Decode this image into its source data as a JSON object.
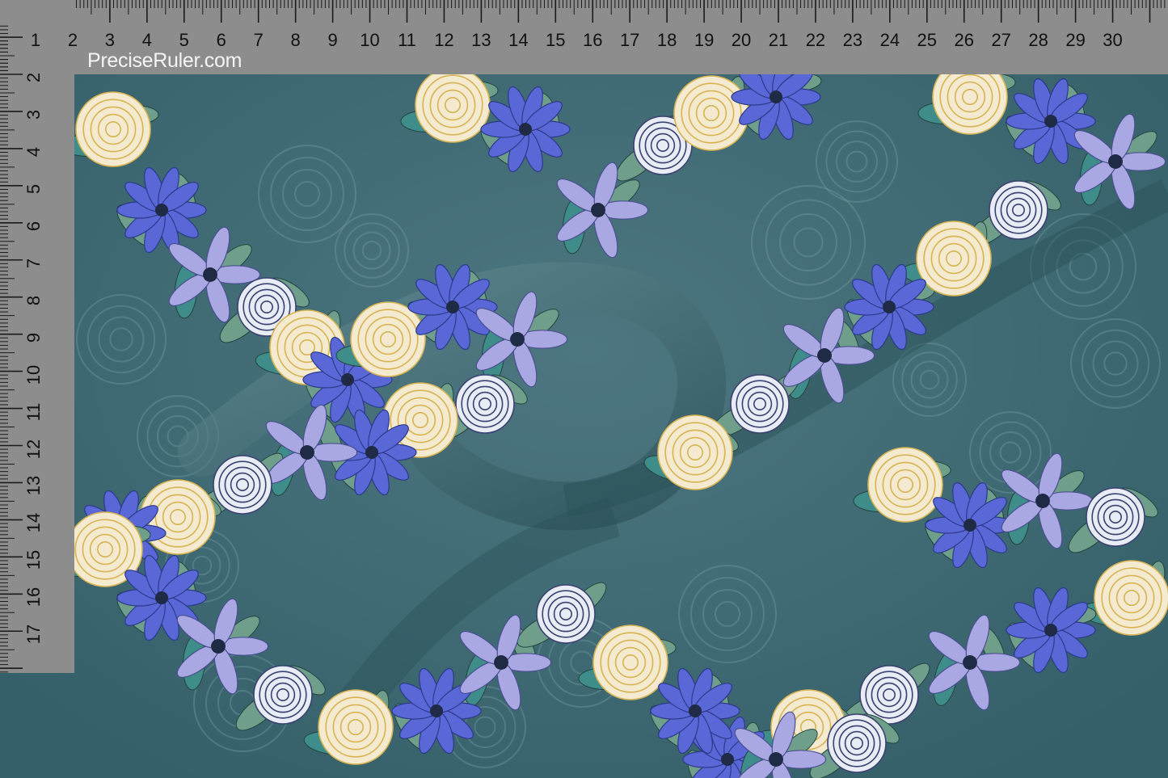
{
  "ruler": {
    "brand": "PreciseRuler.com",
    "top_labels": [
      "1",
      "2",
      "3",
      "4",
      "5",
      "6",
      "7",
      "8",
      "9",
      "10",
      "11",
      "12",
      "13",
      "14",
      "15",
      "16",
      "17",
      "18",
      "19",
      "20",
      "21",
      "22",
      "23",
      "24",
      "25",
      "26",
      "27",
      "28",
      "29",
      "30"
    ],
    "left_labels": [
      "2",
      "3",
      "4",
      "5",
      "6",
      "7",
      "8",
      "9",
      "10",
      "11",
      "12",
      "13",
      "14",
      "15",
      "16",
      "17"
    ]
  },
  "colors": {
    "ruler_bg": "#8d8d8d",
    "fabric_base": "#3f6872",
    "fabric_light": "#5d8791",
    "flower_blue": "#5a67d6",
    "flower_lavender": "#a9a8e2",
    "flower_cream": "#f3ead0",
    "flower_gold": "#d8b353",
    "leaf_green": "#6f9f8a",
    "leaf_teal": "#3e8d8a"
  },
  "image": {
    "subject": "draped teal fabric with watercolor floral print",
    "icons": [
      "ruler",
      "fabric-swatch"
    ]
  }
}
